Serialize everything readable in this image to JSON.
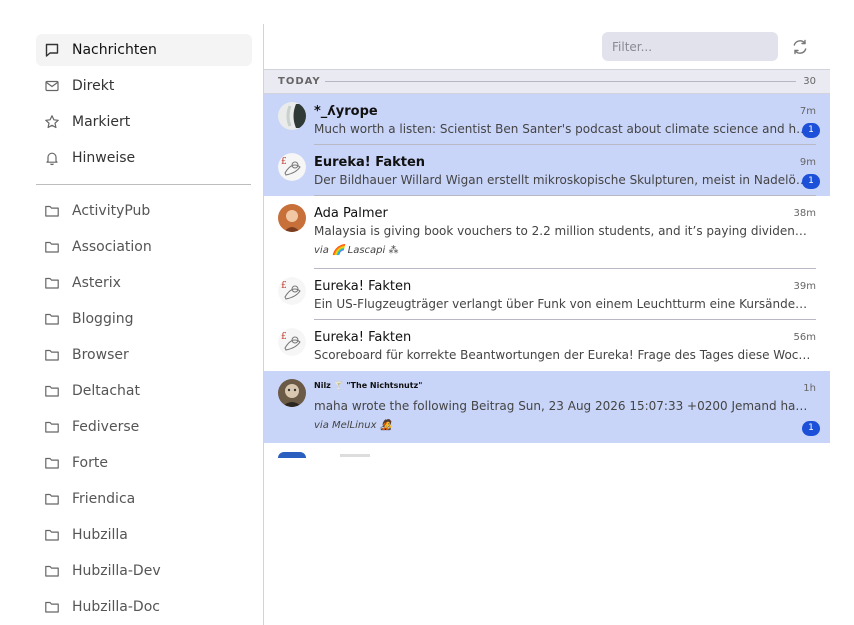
{
  "sidebar": {
    "primary": [
      {
        "label": "Nachrichten",
        "icon": "message-icon"
      },
      {
        "label": "Direkt",
        "icon": "mail-icon"
      },
      {
        "label": "Markiert",
        "icon": "star-icon"
      },
      {
        "label": "Hinweise",
        "icon": "bell-icon"
      }
    ],
    "folders": [
      {
        "label": "ActivityPub",
        "icon": "folder-icon"
      },
      {
        "label": "Association",
        "icon": "folder-icon"
      },
      {
        "label": "Asterix",
        "icon": "folder-icon"
      },
      {
        "label": "Blogging",
        "icon": "folder-icon"
      },
      {
        "label": "Browser",
        "icon": "folder-icon"
      },
      {
        "label": "Deltachat",
        "icon": "folder-icon"
      },
      {
        "label": "Fediverse",
        "icon": "folder-icon"
      },
      {
        "label": "Forte",
        "icon": "folder-icon"
      },
      {
        "label": "Friendica",
        "icon": "folder-icon"
      },
      {
        "label": "Hubzilla",
        "icon": "folder-icon"
      },
      {
        "label": "Hubzilla-Dev",
        "icon": "folder-icon"
      },
      {
        "label": "Hubzilla-Doc",
        "icon": "folder-icon"
      }
    ]
  },
  "toolbar": {
    "filter_placeholder": "Filter...",
    "filter_value": "",
    "refresh_icon": "refresh-icon"
  },
  "list": {
    "section_label": "TODAY",
    "section_count": "30",
    "messages": [
      {
        "name": "*_ʎyrope",
        "time": "7m",
        "preview": "Much worth a listen: Scientist Ben Santer's podcast about climate science and how it's...",
        "badge": "1",
        "unread": true
      },
      {
        "name": "Eureka! Fakten",
        "time": "9m",
        "preview": "Der Bildhauer Willard Wigan erstellt mikroskopische Skulpturen, meist in Nadelöhren...",
        "badge": "1",
        "unread": true
      },
      {
        "name": "Ada Palmer",
        "time": "38m",
        "preview": "Malaysia is giving book vouchers to 2.2 million students, and it’s paying dividends. Ever...",
        "via": "via 🌈 Lascapi ⁂",
        "unread": false
      },
      {
        "name": "Eureka! Fakten",
        "time": "39m",
        "preview": "Ein US-Flugzeugträger verlangt über Funk von einem Leuchtturm eine Kursänderung u...",
        "unread": false
      },
      {
        "name": "Eureka! Fakten",
        "time": "56m",
        "preview": "Scoreboard für korrekte Beantwortungen der Eureka! Frage des Tages diese Woche...",
        "unread": false
      },
      {
        "name": "Nilz 🍸 \"The Nichtsnutz\"",
        "time": "1h",
        "preview": "maha wrote the following Beitrag Sun, 23 Aug 2026 15:07:33 +0200 Jemand hat ist mit...",
        "via": "via MelLinux 🧑‍🎤",
        "badge": "1",
        "unread": true
      }
    ]
  },
  "colors": {
    "unread_bg": "#c9d5f8",
    "badge_bg": "#1c50d8",
    "filter_bg": "#e2e2ec",
    "section_bg": "#eaeaf3"
  }
}
